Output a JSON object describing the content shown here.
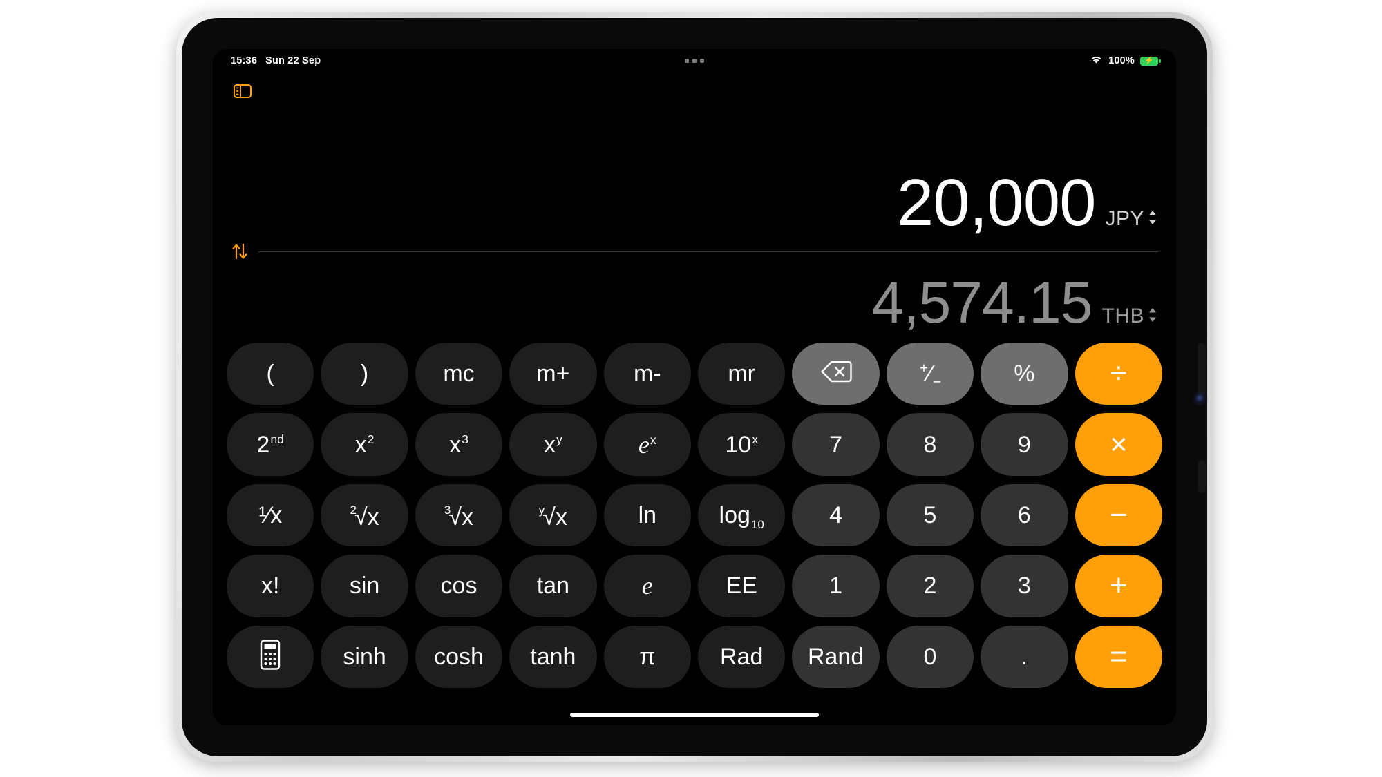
{
  "status_bar": {
    "time": "15:36",
    "date": "Sun 22 Sep",
    "battery_percent": "100%",
    "wifi_icon": "wifi-icon",
    "battery_icon": "battery-charging-icon",
    "multitasking_icon": "multitasking-dots-icon"
  },
  "toolbar": {
    "sidebar_toggle_icon": "sidebar-toggle-icon",
    "accent_color": "#ff9f0a"
  },
  "display": {
    "primary_value": "20,000",
    "primary_unit": "JPY",
    "secondary_value": "4,574.15",
    "secondary_unit": "THB",
    "swap_icon": "swap-arrows-icon",
    "unit_selector_icon": "chevron-up-down-icon",
    "primary_color": "#ffffff",
    "secondary_color": "#8e8e8e"
  },
  "keypad": {
    "colors": {
      "function_key": "#1e1e1e",
      "digit_key": "#333333",
      "utility_key": "#6e6e6e",
      "operator_key": "#ff9f0a"
    },
    "rows": [
      [
        {
          "label": "(",
          "type": "fn"
        },
        {
          "label": ")",
          "type": "fn"
        },
        {
          "label": "mc",
          "type": "fn"
        },
        {
          "label": "m+",
          "type": "fn"
        },
        {
          "label": "m-",
          "type": "fn"
        },
        {
          "label": "mr",
          "type": "fn"
        },
        {
          "label": "",
          "type": "util",
          "icon": "backspace-icon"
        },
        {
          "label": "+/-",
          "type": "util"
        },
        {
          "label": "%",
          "type": "util"
        },
        {
          "label": "÷",
          "type": "op"
        }
      ],
      [
        {
          "label": "2nd",
          "type": "fn"
        },
        {
          "label": "x²",
          "type": "fn"
        },
        {
          "label": "x³",
          "type": "fn"
        },
        {
          "label": "xʸ",
          "type": "fn"
        },
        {
          "label": "eˣ",
          "type": "fn"
        },
        {
          "label": "10ˣ",
          "type": "fn"
        },
        {
          "label": "7",
          "type": "digit"
        },
        {
          "label": "8",
          "type": "digit"
        },
        {
          "label": "9",
          "type": "digit"
        },
        {
          "label": "×",
          "type": "op"
        }
      ],
      [
        {
          "label": "1/x",
          "type": "fn"
        },
        {
          "label": "²√x",
          "type": "fn"
        },
        {
          "label": "³√x",
          "type": "fn"
        },
        {
          "label": "ʸ√x",
          "type": "fn"
        },
        {
          "label": "ln",
          "type": "fn"
        },
        {
          "label": "log₁₀",
          "type": "fn"
        },
        {
          "label": "4",
          "type": "digit"
        },
        {
          "label": "5",
          "type": "digit"
        },
        {
          "label": "6",
          "type": "digit"
        },
        {
          "label": "−",
          "type": "op"
        }
      ],
      [
        {
          "label": "x!",
          "type": "fn"
        },
        {
          "label": "sin",
          "type": "fn"
        },
        {
          "label": "cos",
          "type": "fn"
        },
        {
          "label": "tan",
          "type": "fn"
        },
        {
          "label": "e",
          "type": "fn"
        },
        {
          "label": "EE",
          "type": "fn"
        },
        {
          "label": "1",
          "type": "digit"
        },
        {
          "label": "2",
          "type": "digit"
        },
        {
          "label": "3",
          "type": "digit"
        },
        {
          "label": "+",
          "type": "op"
        }
      ],
      [
        {
          "label": "",
          "type": "fn",
          "icon": "calculator-icon"
        },
        {
          "label": "sinh",
          "type": "fn"
        },
        {
          "label": "cosh",
          "type": "fn"
        },
        {
          "label": "tanh",
          "type": "fn"
        },
        {
          "label": "π",
          "type": "fn"
        },
        {
          "label": "Rad",
          "type": "fn"
        },
        {
          "label": "Rand",
          "type": "digit"
        },
        {
          "label": "0",
          "type": "digit"
        },
        {
          "label": ".",
          "type": "digit"
        },
        {
          "label": "=",
          "type": "op"
        }
      ]
    ]
  },
  "home_indicator": "home-indicator"
}
